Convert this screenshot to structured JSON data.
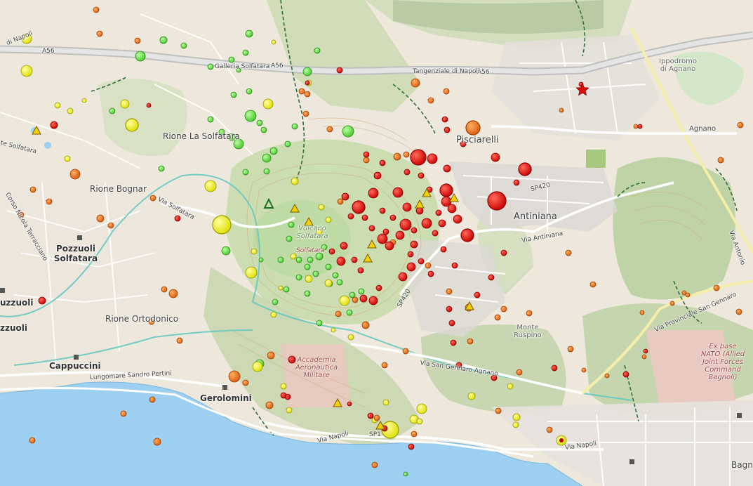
{
  "map": {
    "place_labels": [
      {
        "id": "rione-la-solfatara",
        "text": "Rione La Solfatara"
      },
      {
        "id": "rione-bognar",
        "text": "Rione Bognar"
      },
      {
        "id": "pozzuoli-solfatara",
        "text": "Pozzuoli\nSolfatara"
      },
      {
        "id": "rione-ortodonico",
        "text": "Rione Ortodonico"
      },
      {
        "id": "cappuccini",
        "text": "Cappuccini"
      },
      {
        "id": "gerolomini",
        "text": "Gerolomini"
      },
      {
        "id": "pisciarelli",
        "text": "Pisciarelli"
      },
      {
        "id": "antiniana",
        "text": "Antiniana"
      },
      {
        "id": "agnano",
        "text": "Agnano"
      },
      {
        "id": "ippodromo",
        "text": "Ippodromo\ndi Agnano"
      },
      {
        "id": "monte-ruspino",
        "text": "Monte\nRuspino"
      },
      {
        "id": "uzzuoli",
        "text": "uzzuoli"
      },
      {
        "id": "zzuoli",
        "text": "zzuoli"
      },
      {
        "id": "bagno",
        "text": "Bagn"
      }
    ],
    "road_labels": [
      {
        "id": "a56-west",
        "text": "A56"
      },
      {
        "id": "a56-galleria",
        "text": "A56"
      },
      {
        "id": "a56-east",
        "text": "A56"
      },
      {
        "id": "galleria-solfatara",
        "text": "Galleria Solfatara"
      },
      {
        "id": "tangenziale",
        "text": "Tangenziale di Napoli"
      },
      {
        "id": "di-napoli",
        "text": "di Napoli"
      },
      {
        "id": "via-solfatara",
        "text": "Via Solfatara"
      },
      {
        "id": "sp420-east",
        "text": "SP420"
      },
      {
        "id": "sp420-center",
        "text": "SP420"
      },
      {
        "id": "via-antiniana",
        "text": "Via Antiniana"
      },
      {
        "id": "via-san-gennaro",
        "text": "Via San Gennaro Agnano"
      },
      {
        "id": "via-provinciale",
        "text": "Via Provinciale San Gennaro"
      },
      {
        "id": "via-antonio",
        "text": "Via Antonio"
      },
      {
        "id": "lungomare",
        "text": "Lungomare Sandro Pertini"
      },
      {
        "id": "corso-nicola",
        "text": "Corso Nicola Terracciano"
      },
      {
        "id": "via-napoli",
        "text": "Via Napoli"
      },
      {
        "id": "via-napoli-east",
        "text": "Via Napoli"
      },
      {
        "id": "sp1",
        "text": "SP1"
      },
      {
        "id": "solfatara-left",
        "text": "te Solfatara"
      }
    ],
    "poi_labels": [
      {
        "id": "vulcano",
        "text": "Vulcano\nSolfatara"
      },
      {
        "id": "solfatara-poi",
        "text": "Solfatara"
      },
      {
        "id": "accademia",
        "text": "Accademia\nAeronautica\nMilitare"
      },
      {
        "id": "nato",
        "text": "Ex base\nNATO (Allied\nJoint Forces\nCommand\nBagnoli)"
      }
    ],
    "legend_colors": {
      "red": "#e00000",
      "orange": "#f07818",
      "yellow": "#f5f500",
      "green": "#62e040",
      "water": "#9ccff0",
      "land": "#eee8dc"
    },
    "station_markers": [
      {
        "type": "triangle",
        "count": 13
      },
      {
        "type": "star",
        "count": 1
      }
    ]
  }
}
